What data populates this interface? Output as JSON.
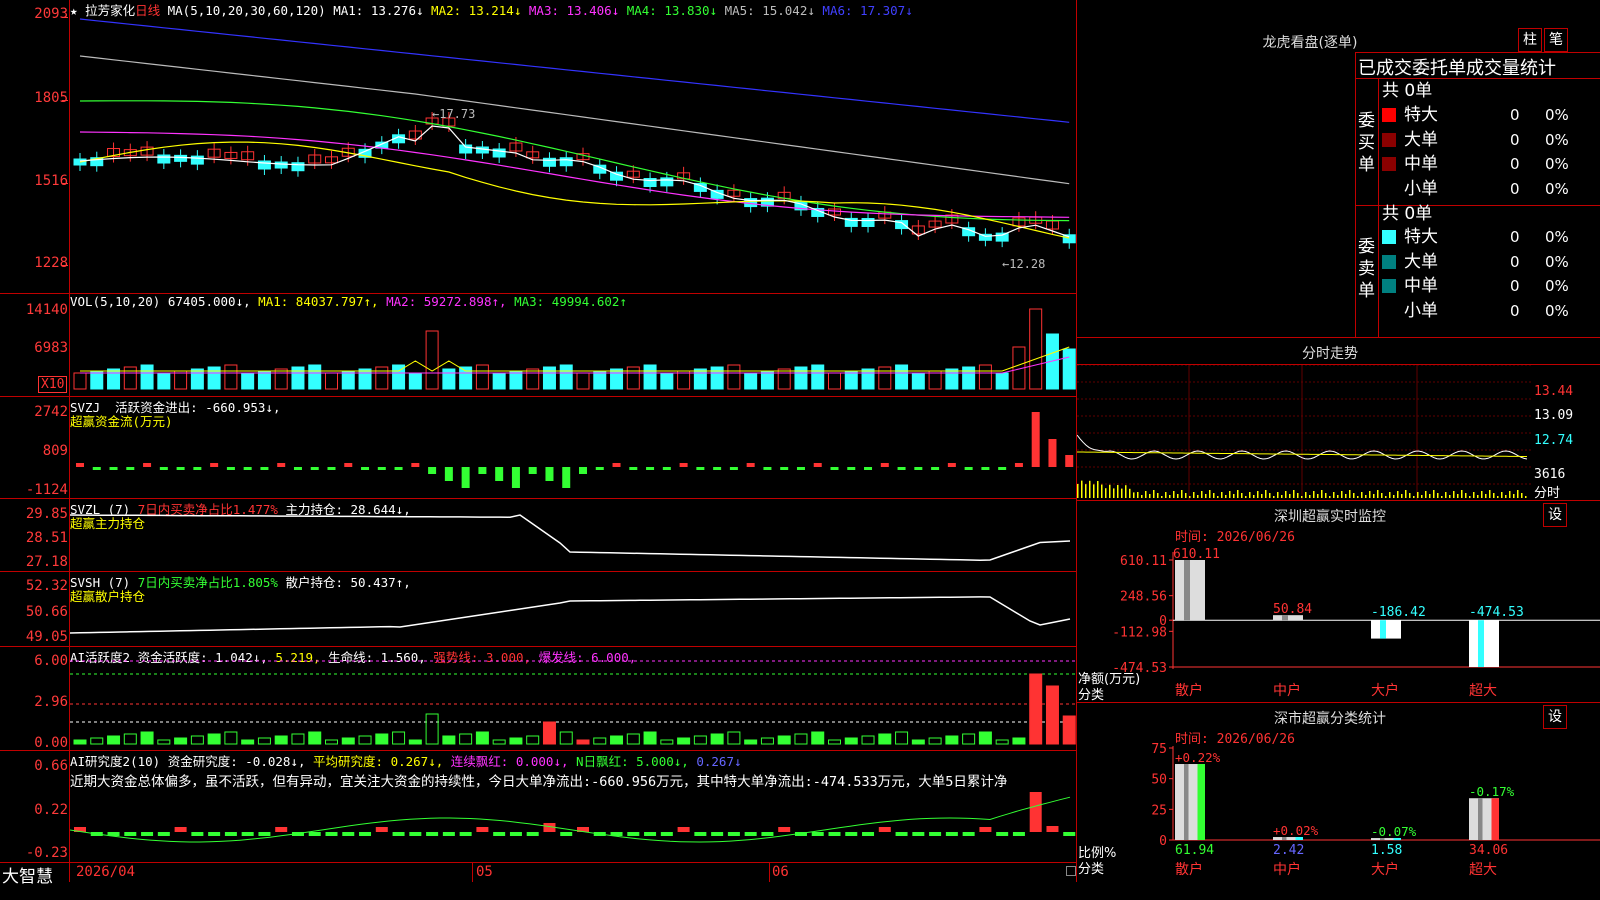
{
  "header": {
    "stock_name": "拉芳家化",
    "period": "日线",
    "ma_label": "MA(5,10,20,30,60,120)",
    "ma1": "MA1: 13.276↓",
    "ma2": "MA2: 13.214↓",
    "ma3": "MA3: 13.406↓",
    "ma4": "MA4: 13.830↓",
    "ma5": "MA5: 15.042↓",
    "ma6": "MA6: 17.307↓"
  },
  "price_axis": [
    "2093",
    "1805",
    "1516",
    "1228"
  ],
  "price_annotations": {
    "high": "17.73",
    "low": "12.28"
  },
  "colors": {
    "up": "#ff3333",
    "down": "#33ffff",
    "ma1": "#ffffff",
    "ma2": "#ffff00",
    "ma3": "#ff33ff",
    "ma4": "#33ff33",
    "ma5": "#cccccc",
    "ma6": "#3333ff",
    "frame": "#c00000"
  },
  "vol": {
    "title": "VOL(5,10,20)",
    "value": "67405.000↓,",
    "ma1": "MA1: 84037.797↑,",
    "ma2": "MA2: 59272.898↑,",
    "ma3": "MA3: 49994.602↑",
    "axis": [
      "14140",
      "6983"
    ],
    "unit": "X10"
  },
  "svzj": {
    "title": "SVZJ",
    "text": "活跃资金进出: -660.953↓,",
    "subtitle": "超赢资金流(万元)",
    "axis": [
      "2742",
      "809",
      "-1124"
    ]
  },
  "svzl": {
    "title": "SVZL (7)",
    "text1": "7日内买卖净占比1.477%",
    "text2": "主力持仓: 28.644↓,",
    "subtitle": "超赢主力持仓",
    "axis": [
      "29.85",
      "28.51",
      "27.18"
    ]
  },
  "svsh": {
    "title": "SVSH (7)",
    "text1": "7日内买卖净占比1.805%",
    "text2": "散户持仓: 50.437↑,",
    "subtitle": "超赢散户持仓",
    "axis": [
      "52.32",
      "50.66",
      "49.05"
    ]
  },
  "ai_active": {
    "title": "AI活跃度2",
    "t1": "资金活跃度: 1.042↓,",
    "t2": "5.219,",
    "t3": "生命线: 1.560,",
    "t4": "强势线: 3.000,",
    "t5": "爆发线: 6.000,",
    "axis": [
      "6.00",
      "2.96",
      "0.00"
    ]
  },
  "ai_research": {
    "title": "AI研究度2(10)",
    "t1": "资金研究度: -0.028↓,",
    "t2": "平均研究度: 0.267↓,",
    "t3": "连续飘红: 0.000↓,",
    "t4": "N日飘红: 5.000↓,",
    "t5": "0.267↓",
    "comment": "近期大资金总体偏多，虽不活跃，但有异动，宜关注大资金的持续性，今日大单净流出:-660.956万元，其中特大单净流出:-474.533万元，大单5日累计净",
    "axis": [
      "0.66",
      "0.22",
      "-0.23"
    ]
  },
  "footer": {
    "app_name": "大智慧",
    "date_start": "2026/04",
    "m05": "05",
    "m06": "06"
  },
  "lhb": {
    "title": "龙虎看盘(逐单)",
    "btn_zhu": "柱",
    "btn_bi": "笔",
    "subtitle": "已成交委托单成交量统计",
    "buy_label": "委买单",
    "sell_label": "委卖单",
    "buy_total": "共 0单",
    "sell_total": "共 0单",
    "rows": [
      "特大",
      "大单",
      "中单",
      "小单"
    ],
    "buy_vals": [
      "0",
      "0",
      "0",
      "0"
    ],
    "sell_vals": [
      "0",
      "0",
      "0",
      "0"
    ],
    "pct": "0%"
  },
  "fenshi": {
    "title": "分时走势",
    "axis": [
      "13.44",
      "13.09",
      "12.74",
      "3616"
    ],
    "unit": "分时"
  },
  "sz_monitor": {
    "title": "深圳超赢实时监控",
    "btn": "设",
    "date": "时间: 2026/06/26",
    "axis": [
      "610.11",
      "248.56",
      "0",
      "-112.98",
      "-474.53"
    ],
    "ylabel": "净额(万元)",
    "xlabel": "分类",
    "categories": [
      "散户",
      "中户",
      "大户",
      "超大"
    ],
    "values": [
      610.11,
      50.84,
      -186.42,
      -474.53
    ],
    "labels": [
      "610.11",
      "50.84",
      "-186.42",
      "-474.53"
    ]
  },
  "sz_class": {
    "title": "深市超赢分类统计",
    "btn": "设",
    "date": "时间: 2026/06/26",
    "axis": [
      "75",
      "50",
      "25",
      "0"
    ],
    "ylabel": "比例%",
    "xlabel": "分类",
    "categories": [
      "散户",
      "中户",
      "大户",
      "超大"
    ],
    "values": [
      61.94,
      2.42,
      1.58,
      34.06
    ],
    "pct_labels": [
      "+0.22%",
      "+0.02%",
      "-0.07%",
      "-0.17%"
    ],
    "val_labels": [
      "61.94",
      "2.42",
      "1.58",
      "34.06"
    ]
  }
}
